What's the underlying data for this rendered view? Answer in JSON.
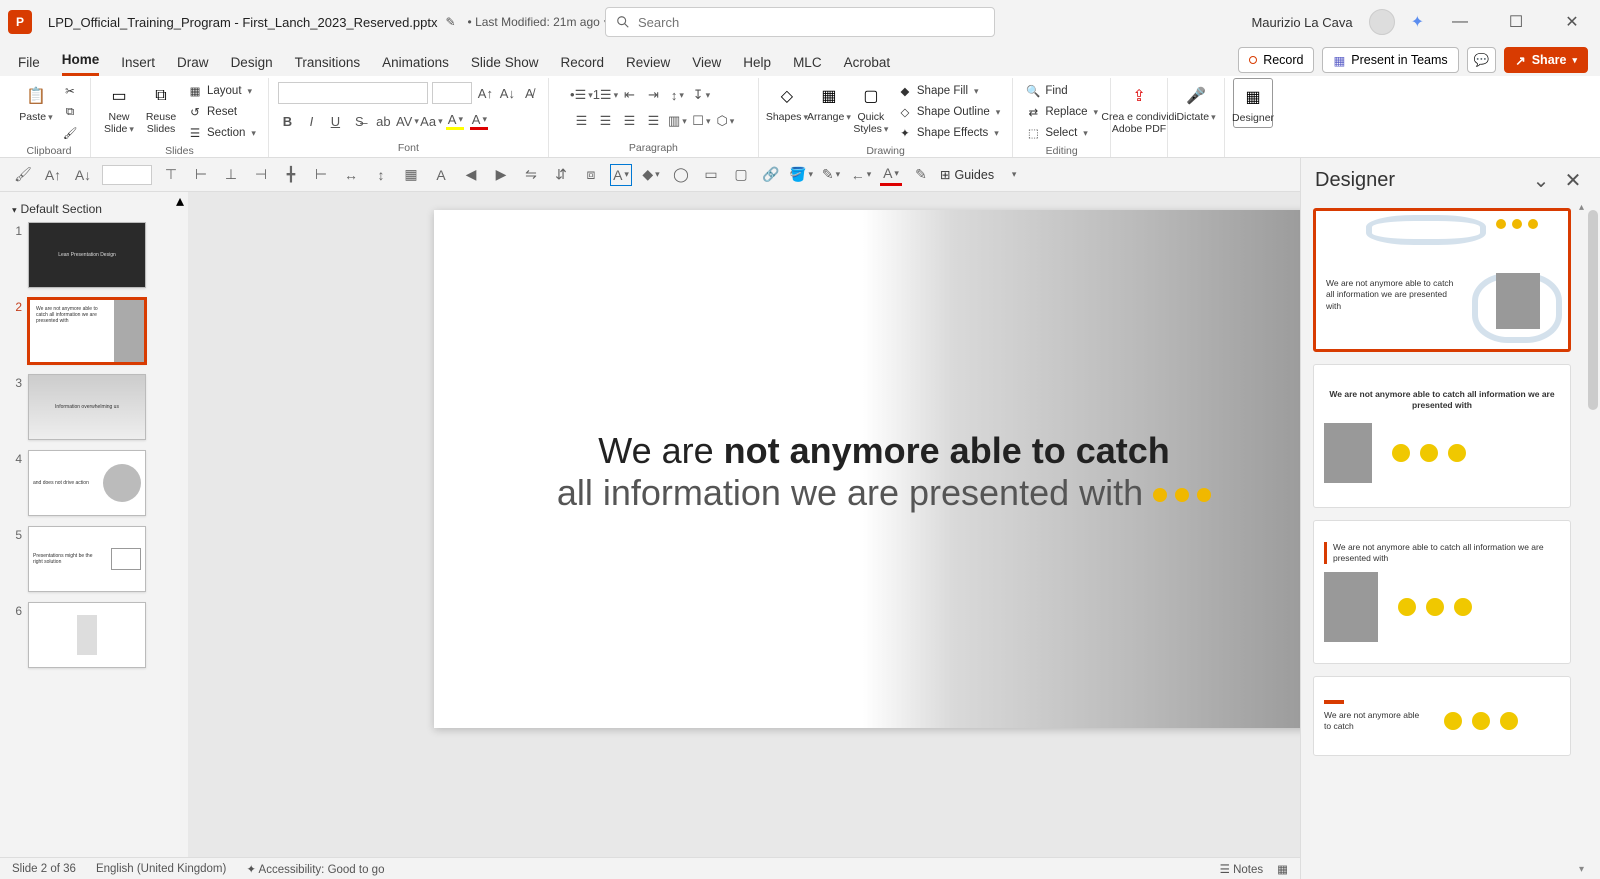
{
  "title": {
    "filename": "LPD_Official_Training_Program - First_Lanch_2023_Reserved.pptx",
    "last_modified": "• Last Modified: 21m ago",
    "search_placeholder": "Search",
    "username": "Maurizio La Cava"
  },
  "window_buttons": {
    "min": "—",
    "max": "☐",
    "close": "✕"
  },
  "tabs": [
    "File",
    "Home",
    "Insert",
    "Draw",
    "Design",
    "Transitions",
    "Animations",
    "Slide Show",
    "Record",
    "Review",
    "View",
    "Help",
    "MLC",
    "Acrobat"
  ],
  "active_tab": "Home",
  "tab_actions": {
    "record": "Record",
    "present": "Present in Teams",
    "comments": "💬",
    "share": "Share"
  },
  "ribbon": {
    "clipboard": {
      "paste": "Paste",
      "label": "Clipboard"
    },
    "slides": {
      "new": "New\nSlide",
      "reuse": "Reuse\nSlides",
      "layout": "Layout",
      "reset": "Reset",
      "section": "Section",
      "label": "Slides"
    },
    "font": {
      "label": "Font"
    },
    "paragraph": {
      "label": "Paragraph"
    },
    "drawing": {
      "shapes": "Shapes",
      "arrange": "Arrange",
      "quick": "Quick\nStyles",
      "fill": "Shape Fill",
      "outline": "Shape Outline",
      "effects": "Shape Effects",
      "label": "Drawing"
    },
    "editing": {
      "find": "Find",
      "replace": "Replace",
      "select": "Select",
      "label": "Editing"
    },
    "adobe": {
      "label": "Crea e condividi\nAdobe PDF"
    },
    "voice": {
      "dictate": "Dictate"
    },
    "designer": {
      "label": "Designer"
    }
  },
  "qat2": {
    "guides": "Guides"
  },
  "thumbs": {
    "section": "Default Section",
    "slides": [
      {
        "n": "1",
        "kind": "dark",
        "txt": "Lean Presentation Design"
      },
      {
        "n": "2",
        "kind": "sel",
        "txt": "We are not anymore able to catch all information we are presented with"
      },
      {
        "n": "3",
        "kind": "light",
        "txt": "Information overwhelming us"
      },
      {
        "n": "4",
        "kind": "light",
        "txt": "and does not drive action"
      },
      {
        "n": "5",
        "kind": "light",
        "txt": "Presentations might be the right solution"
      },
      {
        "n": "6",
        "kind": "light",
        "txt": ""
      }
    ]
  },
  "slide": {
    "line1_pre": "We are ",
    "line1_bold": "not anymore able to catch",
    "line2": "all information we are presented with"
  },
  "designer_pane": {
    "title": "Designer",
    "ideas": [
      {
        "txt": "We are not anymore able to catch all information we are presented with"
      },
      {
        "txt": "We are not anymore able to catch all information we are presented with"
      },
      {
        "txt": "We are not anymore able to catch all information we are presented with"
      },
      {
        "txt": "We are not anymore able to catch"
      }
    ]
  },
  "status": {
    "slide": "Slide 2 of 36",
    "lang": "English (United Kingdom)",
    "access": "Accessibility: Good to go",
    "notes": "Notes"
  }
}
